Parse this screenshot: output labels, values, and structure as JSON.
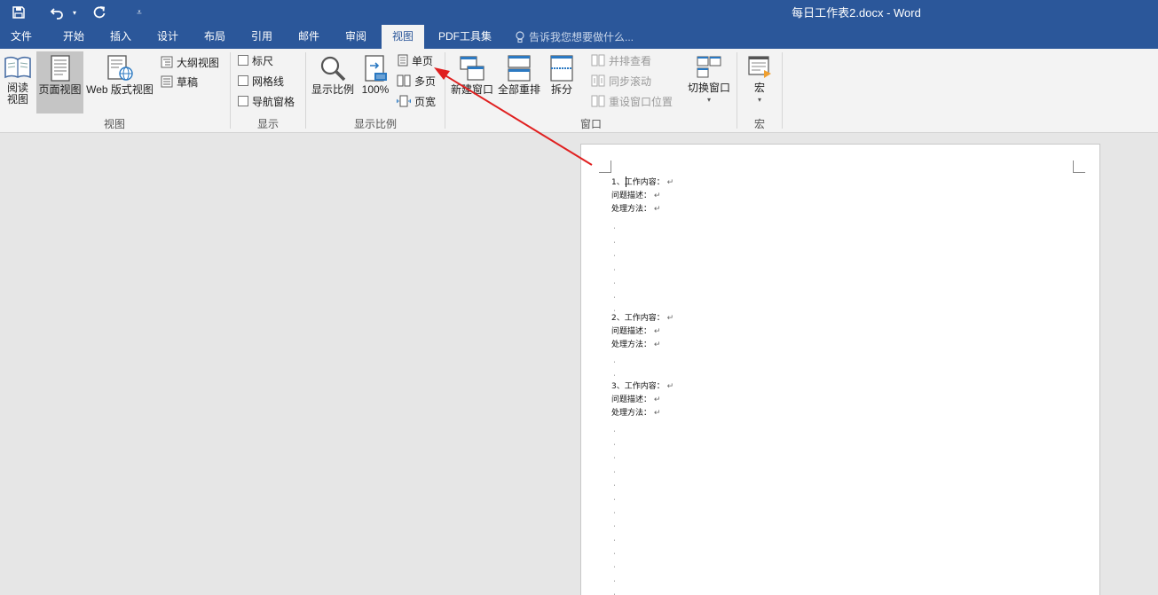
{
  "window": {
    "title": "每日工作表2.docx - Word"
  },
  "quick_access": {
    "save_icon": "save-icon",
    "undo_icon": "undo-icon",
    "redo_icon": "repeat-icon",
    "customize_icon": "customize-qat-icon"
  },
  "tabs": [
    {
      "label": "文件"
    },
    {
      "label": "开始"
    },
    {
      "label": "插入"
    },
    {
      "label": "设计"
    },
    {
      "label": "布局"
    },
    {
      "label": "引用"
    },
    {
      "label": "邮件"
    },
    {
      "label": "审阅"
    },
    {
      "label": "视图",
      "active": true
    },
    {
      "label": "PDF工具集"
    }
  ],
  "tell_me": {
    "placeholder": "告诉我您想要做什么..."
  },
  "ribbon": {
    "views": {
      "read_mode": [
        "阅读",
        "视图"
      ],
      "print_layout": "页面视图",
      "web_layout": "Web 版式视图",
      "outline": "大纲视图",
      "draft": "草稿",
      "group_label": "视图"
    },
    "show": {
      "ruler": "标尺",
      "gridlines": "网格线",
      "nav_pane": "导航窗格",
      "group_label": "显示"
    },
    "zoom": {
      "zoom": "显示比例",
      "hundred": "100%",
      "one_page": "单页",
      "multi_page": "多页",
      "page_width": "页宽",
      "group_label": "显示比例"
    },
    "window": {
      "new_window": "新建窗口",
      "arrange_all": "全部重排",
      "split": "拆分",
      "side_by_side": "并排查看",
      "sync_scroll": "同步滚动",
      "reset_position": "重设窗口位置",
      "switch_windows": "切换窗口",
      "group_label": "窗口"
    },
    "macros": {
      "macros": "宏",
      "group_label": "宏"
    }
  },
  "document": {
    "lines": [
      {
        "text": "1、工作内容：",
        "mark": "↵"
      },
      {
        "text": "问题描述：",
        "mark": "↵"
      },
      {
        "text": "处理方法：",
        "mark": "↵"
      },
      {
        "text": "2、工作内容：",
        "mark": "↵"
      },
      {
        "text": "问题描述：",
        "mark": "↵"
      },
      {
        "text": "处理方法：",
        "mark": "↵"
      },
      {
        "text": "3、工作内容：",
        "mark": "↵"
      },
      {
        "text": "问题描述：",
        "mark": "↵"
      },
      {
        "text": "处理方法：",
        "mark": "↵"
      }
    ]
  },
  "colors": {
    "accent": "#2b579a",
    "annotation_arrow": "#e02020"
  }
}
